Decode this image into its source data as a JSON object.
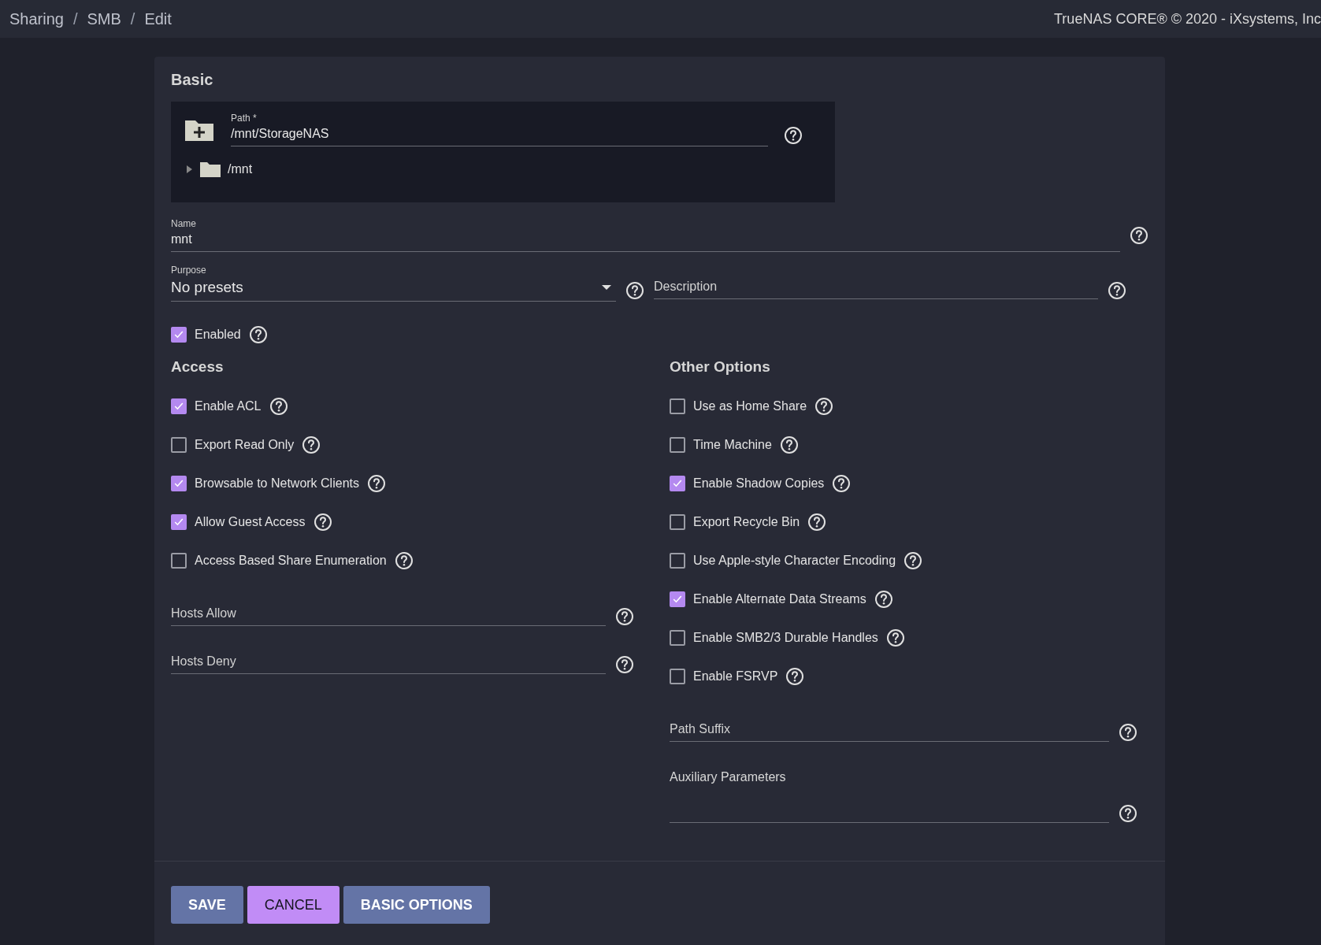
{
  "breadcrumb": [
    "Sharing",
    "SMB",
    "Edit"
  ],
  "breadcrumb_separator": "/",
  "copyright": "TrueNAS CORE® © 2020 - iXsystems, Inc",
  "basic": {
    "title": "Basic",
    "path": {
      "label": "Path *",
      "value": "/mnt/StorageNAS",
      "tree": [
        {
          "name": "/mnt",
          "expanded": false
        }
      ]
    },
    "name": {
      "label": "Name",
      "value": "mnt"
    },
    "purpose": {
      "label": "Purpose",
      "value": "No presets"
    },
    "description": {
      "placeholder": "Description"
    },
    "enabled": {
      "label": "Enabled",
      "checked": true
    }
  },
  "access": {
    "title": "Access",
    "options": [
      {
        "label": "Enable ACL",
        "checked": true
      },
      {
        "label": "Export Read Only",
        "checked": false
      },
      {
        "label": "Browsable to Network Clients",
        "checked": true
      },
      {
        "label": "Allow Guest Access",
        "checked": true
      },
      {
        "label": "Access Based Share Enumeration",
        "checked": false
      }
    ],
    "fields": [
      {
        "placeholder": "Hosts Allow"
      },
      {
        "placeholder": "Hosts Deny"
      }
    ]
  },
  "other": {
    "title": "Other Options",
    "options": [
      {
        "label": "Use as Home Share",
        "checked": false
      },
      {
        "label": "Time Machine",
        "checked": false
      },
      {
        "label": "Enable Shadow Copies",
        "checked": true
      },
      {
        "label": "Export Recycle Bin",
        "checked": false
      },
      {
        "label": "Use Apple-style Character Encoding",
        "checked": false
      },
      {
        "label": "Enable Alternate Data Streams",
        "checked": true
      },
      {
        "label": "Enable SMB2/3 Durable Handles",
        "checked": false
      },
      {
        "label": "Enable FSRVP",
        "checked": false
      }
    ],
    "path_suffix": {
      "placeholder": "Path Suffix"
    },
    "aux": {
      "label": "Auxiliary Parameters"
    }
  },
  "buttons": [
    {
      "label": "SAVE",
      "kind": "primary"
    },
    {
      "label": "CANCEL",
      "kind": "accent"
    },
    {
      "label": "BASIC OPTIONS",
      "kind": "primary"
    }
  ]
}
